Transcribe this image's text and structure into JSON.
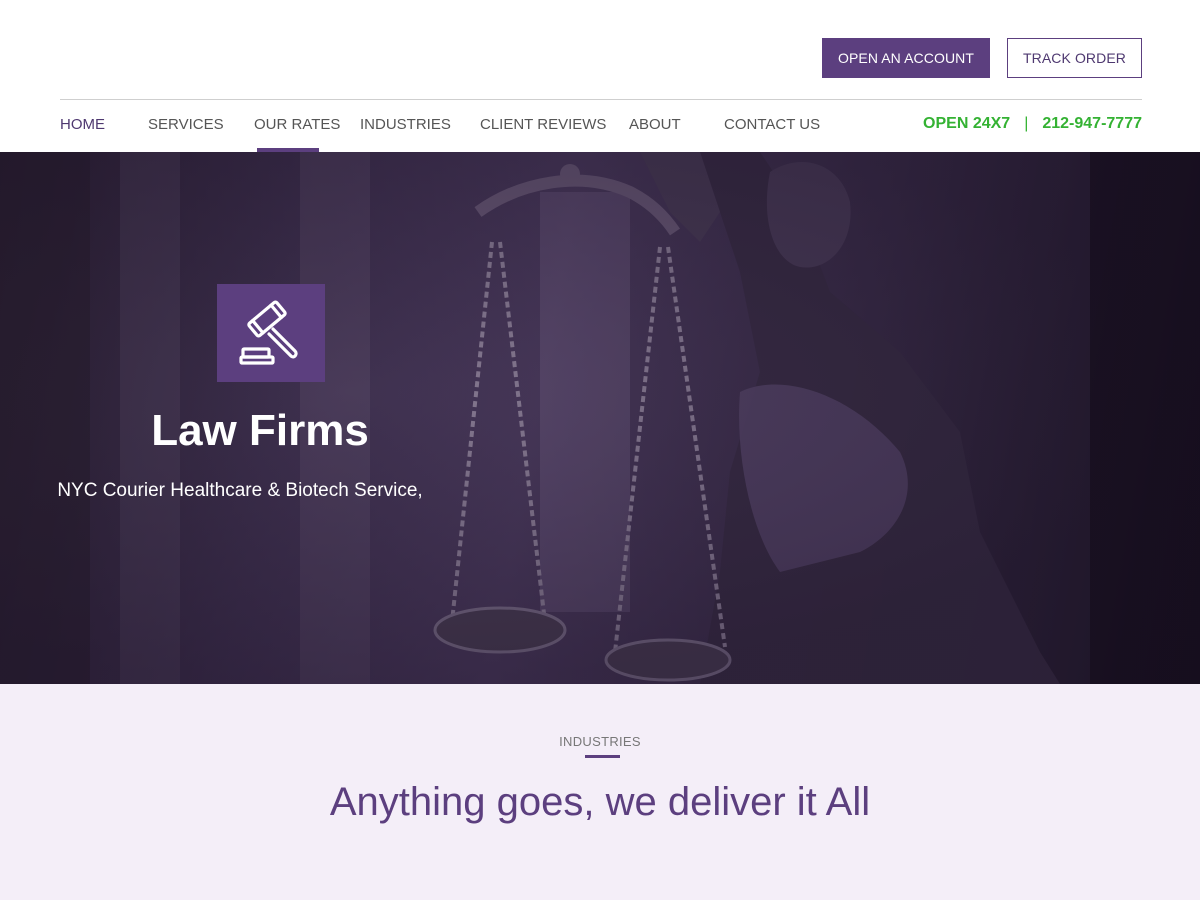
{
  "header": {
    "open_account_label": "OPEN AN ACCOUNT",
    "track_order_label": "TRACK ORDER"
  },
  "nav": {
    "items": [
      {
        "label": "HOME"
      },
      {
        "label": "SERVICES"
      },
      {
        "label": "OUR RATES"
      },
      {
        "label": "INDUSTRIES"
      },
      {
        "label": "CLIENT REVIEWS"
      },
      {
        "label": "ABOUT"
      },
      {
        "label": "CONTACT US"
      }
    ],
    "active_item": "OUR RATES",
    "hours": "OPEN 24X7",
    "separator": "|",
    "phone": "212-947-7777"
  },
  "hero": {
    "icon": "gavel-icon",
    "title": "Law Firms",
    "subtitle": "NYC Courier Healthcare & Biotech  Service,"
  },
  "industries": {
    "label": "INDUSTRIES",
    "heading": "Anything goes, we deliver it All"
  },
  "colors": {
    "brand_purple": "#5c3f7f",
    "phone_green": "#34b233",
    "section_bg": "#f4eef8"
  }
}
